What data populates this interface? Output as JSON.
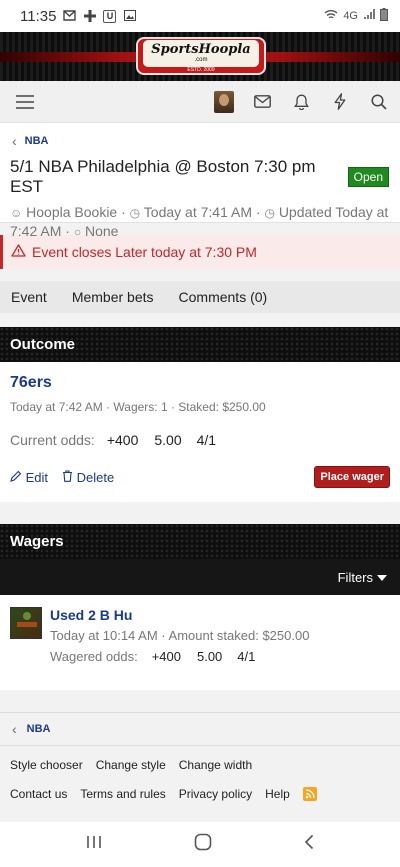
{
  "status_bar": {
    "time": "11:35",
    "network": "4G"
  },
  "banner": {
    "logo_text": "SportsHoopla",
    "logo_sub": ".com",
    "logo_est": "ESTD. 2009"
  },
  "thread": {
    "breadcrumb": "NBA",
    "title": "5/1 NBA Philadelphia @ Boston 7:30 pm EST",
    "status": "Open",
    "author": "Hoopla Bookie",
    "created": "Today at 7:41 AM",
    "updated_prefix": "Updated Today at",
    "updated_time": "7:42 AM",
    "tags": "None"
  },
  "alert": {
    "text": "Event closes Later today at 7:30 PM"
  },
  "tabs": [
    {
      "label": "Event"
    },
    {
      "label": "Member bets"
    },
    {
      "label": "Comments (0)"
    }
  ],
  "outcome": {
    "heading": "Outcome",
    "team": "76ers",
    "meta": "Today at 7:42 AM · Wagers: 1 · Staked: $250.00",
    "odds_label": "Current odds:",
    "odds": [
      "+400",
      "5.00",
      "4/1"
    ],
    "edit": "Edit",
    "delete": "Delete",
    "place": "Place wager"
  },
  "wagers": {
    "heading": "Wagers",
    "filters": "Filters",
    "user": "Used 2 B Hu",
    "meta": "Today at 10:14 AM · Amount staked: $250.00",
    "odds_label": "Wagered odds:",
    "odds": [
      "+400",
      "5.00",
      "4/1"
    ]
  },
  "bottom_crumb": "NBA",
  "footer": {
    "row1": [
      "Style chooser",
      "Change style",
      "Change width"
    ],
    "row2": [
      "Contact us",
      "Terms and rules",
      "Privacy policy",
      "Help"
    ]
  },
  "colors": {
    "link": "#1a3a8a",
    "accent_red": "#c0282b",
    "open_green": "#1f8a1f"
  }
}
